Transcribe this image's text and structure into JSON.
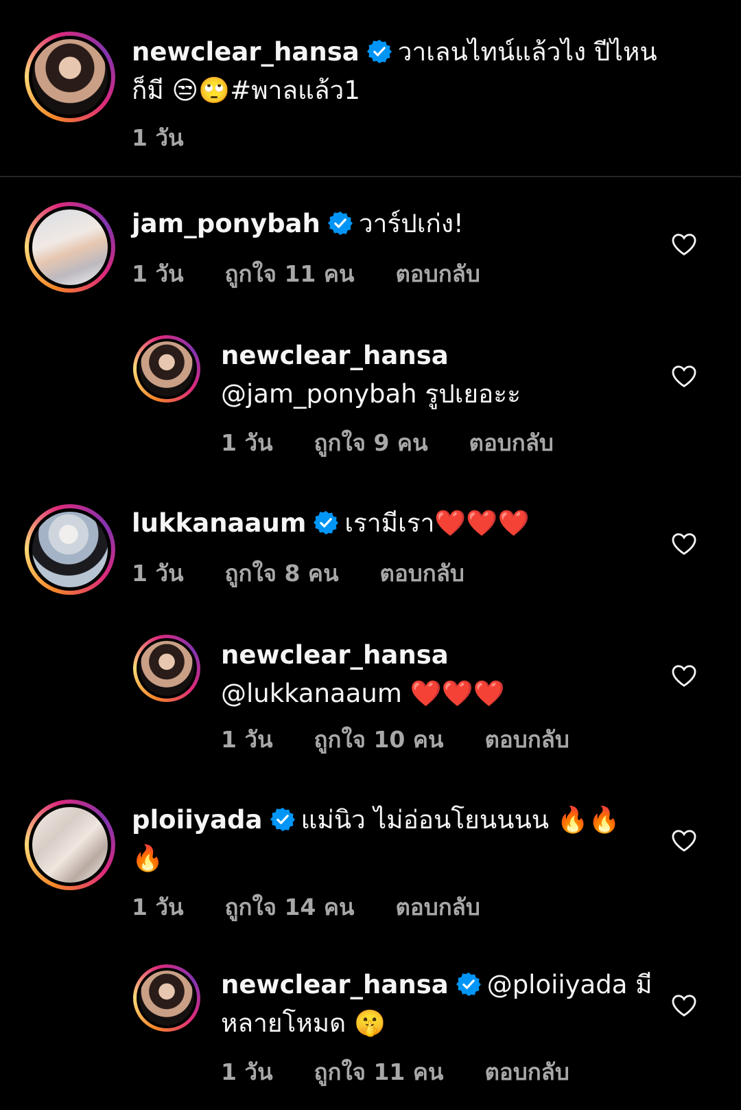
{
  "caption": {
    "username": "newclear_hansa",
    "text": "วาเลนไทน์แล้วไง ปีไหน",
    "text_line2": "ก็มี 😒🙄#พาลแล้ว1",
    "time": "1 วัน"
  },
  "comments": [
    {
      "username": "jam_ponybah",
      "text": "วาร์ปเก่ง!",
      "time": "1 วัน",
      "likes": "ถูกใจ 11 คน",
      "reply": "ตอบกลับ"
    },
    {
      "username": "newclear_hansa",
      "text": "@jam_ponybah รูปเยอะะ",
      "time": "1 วัน",
      "likes": "ถูกใจ 9 คน",
      "reply": "ตอบกลับ"
    },
    {
      "username": "lukkanaaum",
      "text": "เรามีเรา❤️❤️❤️",
      "time": "1 วัน",
      "likes": "ถูกใจ 8 คน",
      "reply": "ตอบกลับ"
    },
    {
      "username": "newclear_hansa",
      "text": "@lukkanaaum ❤️❤️❤️",
      "time": "1 วัน",
      "likes": "ถูกใจ 10 คน",
      "reply": "ตอบกลับ"
    },
    {
      "username": "ploiiyada",
      "text": "แม่นิว ไม่อ่อนโยนนนน 🔥🔥",
      "text_line2": "🔥",
      "time": "1 วัน",
      "likes": "ถูกใจ 14 คน",
      "reply": "ตอบกลับ"
    },
    {
      "username": "newclear_hansa",
      "text": "@ploiiyada มี",
      "text_line2": "หลายโหมด 🤫",
      "time": "1 วัน",
      "likes": "ถูกใจ 11 คน",
      "reply": "ตอบกลับ"
    }
  ],
  "colors": {
    "background": "#000000",
    "verified": "#0095f6",
    "meta": "#a8a8a8"
  },
  "icons": {
    "verified": "verified-badge-icon",
    "like": "heart-outline-icon"
  }
}
